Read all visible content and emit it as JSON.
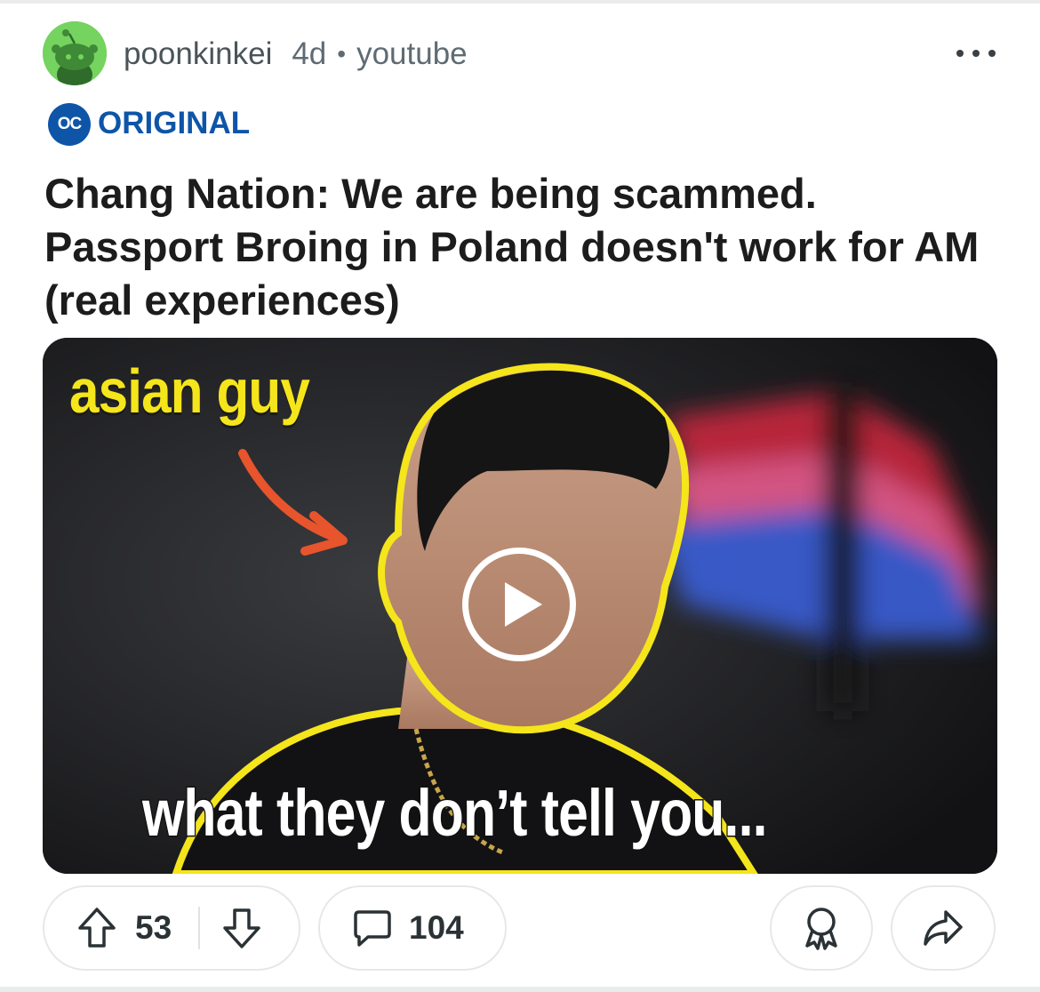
{
  "post": {
    "author": "poonkinkei",
    "age": "4d",
    "separator": "•",
    "source": "youtube",
    "flair": {
      "badge": "OC",
      "label": "ORIGINAL"
    },
    "title": "Chang Nation: We are being scammed. Passport Broing in Poland doesn't work for AM (real experiences)"
  },
  "thumbnail": {
    "top_text": "asian guy",
    "bottom_text": "what they don’t tell you..."
  },
  "actions": {
    "upvotes": "53",
    "comments": "104"
  },
  "colors": {
    "accent_blue": "#0e55a8",
    "avatar_green": "#75d35f",
    "thumb_yellow": "#f5e51b",
    "arrow_orange": "#e8542c"
  },
  "icons": [
    "snoo-avatar-icon",
    "more-options-icon",
    "oc-badge-icon",
    "play-icon",
    "upvote-icon",
    "downvote-icon",
    "comment-icon",
    "award-icon",
    "share-icon"
  ]
}
